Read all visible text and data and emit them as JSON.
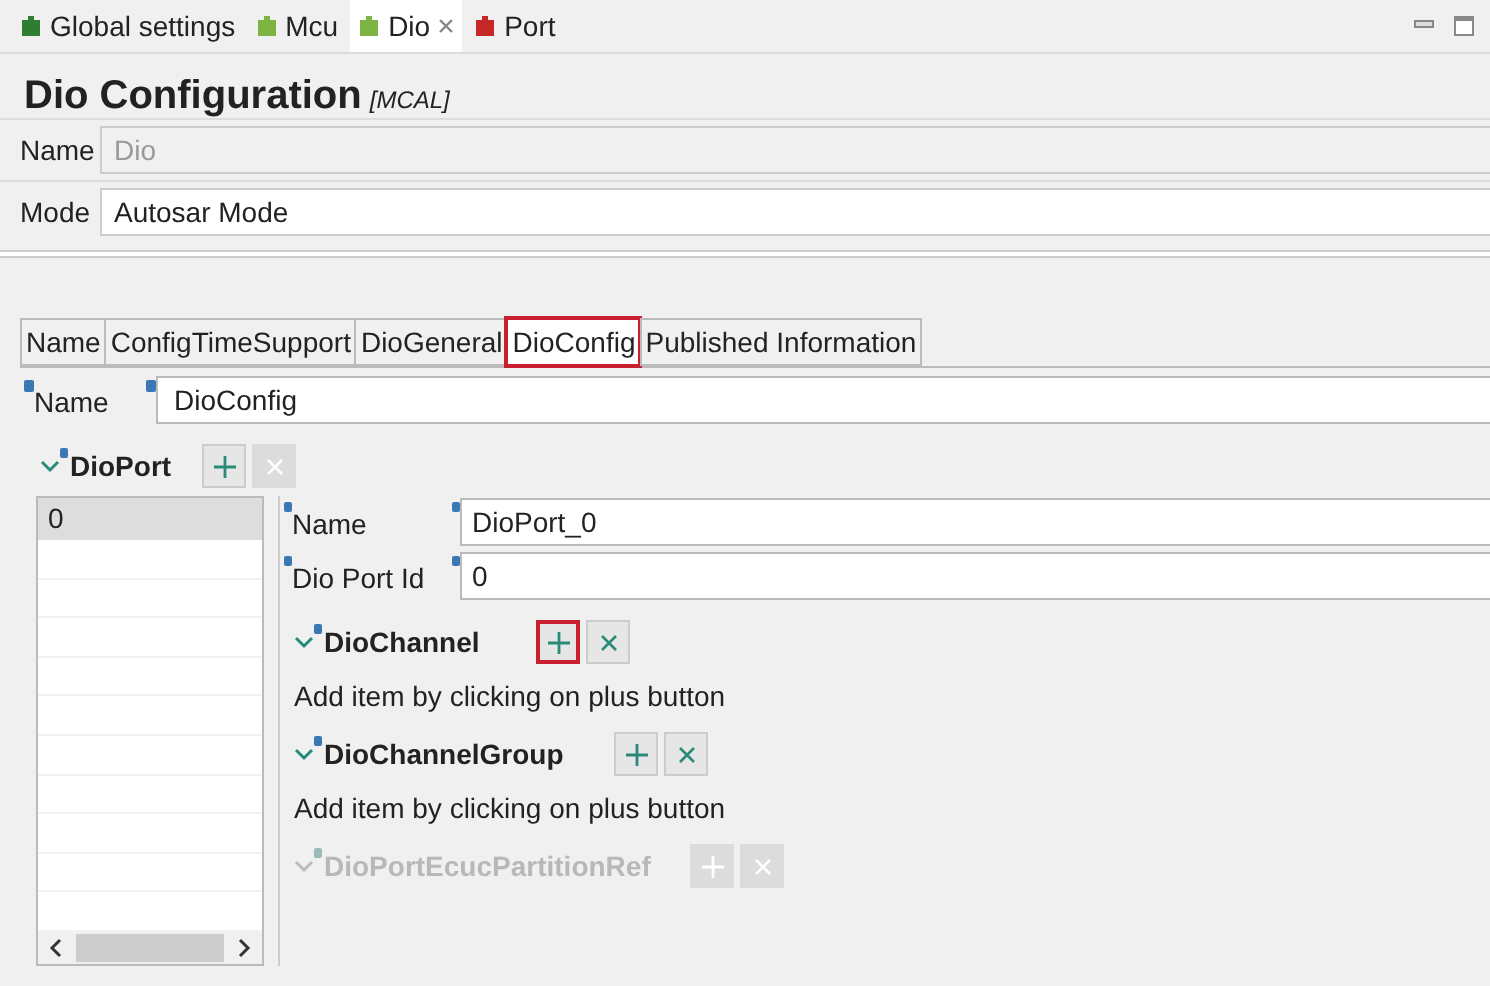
{
  "editor_tabs": [
    {
      "label": "Global settings",
      "selected": false,
      "color": "#2e7d32",
      "closable": false
    },
    {
      "label": "Mcu",
      "selected": false,
      "color": "#7cb342",
      "closable": false
    },
    {
      "label": "Dio",
      "selected": true,
      "color": "#7cb342",
      "closable": true
    },
    {
      "label": "Port",
      "selected": false,
      "color": "#c62828",
      "closable": false
    }
  ],
  "title": "Dio Configuration",
  "title_tag": "[MCAL]",
  "general_fields": [
    {
      "label": "Name",
      "value": "Dio",
      "disabled": true
    },
    {
      "label": "Mode",
      "value": "Autosar Mode",
      "disabled": false
    }
  ],
  "section_tabs": [
    {
      "label": "Name",
      "selected": false,
      "highlighted": false
    },
    {
      "label": "ConfigTimeSupport",
      "selected": false,
      "highlighted": false
    },
    {
      "label": "DioGeneral",
      "selected": false,
      "highlighted": false
    },
    {
      "label": "DioConfig",
      "selected": true,
      "highlighted": true
    },
    {
      "label": "Published Information",
      "selected": false,
      "highlighted": false
    }
  ],
  "config_name": {
    "label": "Name",
    "value": "DioConfig"
  },
  "dio_port": {
    "label": "DioPort",
    "expanded": true,
    "add_enabled": true,
    "remove_enabled": false,
    "list_items": [
      {
        "label": "0",
        "selected": true
      }
    ],
    "fields": [
      {
        "label": "Name",
        "value": "DioPort_0"
      },
      {
        "label": "Dio Port Id",
        "value": "0"
      }
    ],
    "subsections": [
      {
        "label": "DioChannel",
        "expanded": true,
        "enabled": true,
        "add_highlighted": true,
        "message": "Add item by clicking on plus button"
      },
      {
        "label": "DioChannelGroup",
        "expanded": true,
        "enabled": true,
        "add_highlighted": false,
        "message": "Add item by clicking on plus button"
      },
      {
        "label": "DioPortEcucPartitionRef",
        "expanded": true,
        "enabled": false,
        "add_highlighted": false
      }
    ]
  }
}
